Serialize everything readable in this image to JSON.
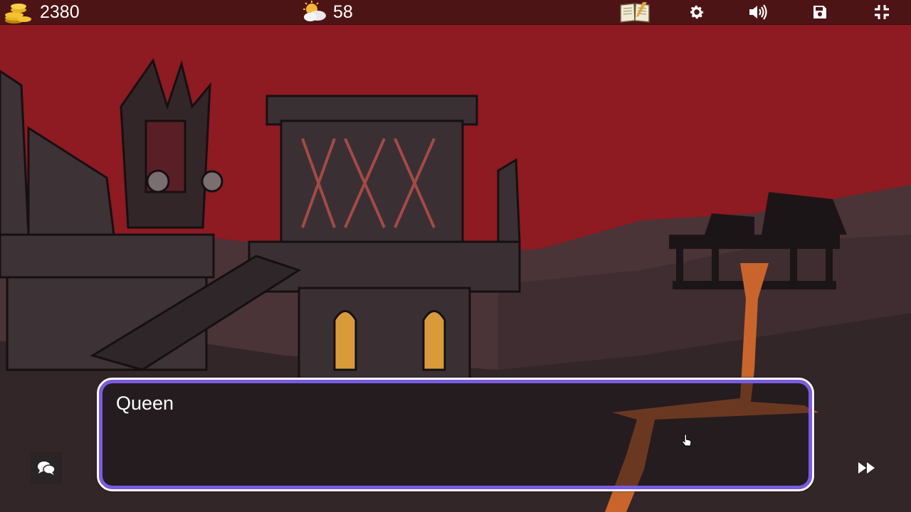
{
  "hud": {
    "gold": "2380",
    "weather_value": "58",
    "icons": {
      "gold": "coin-stack-icon",
      "weather": "sun-cloud-icon",
      "journal": "journal-book-icon",
      "settings": "gear-icon",
      "sound": "speaker-volume-icon",
      "save": "floppy-disk-icon",
      "fullscreen": "collapse-fullscreen-icon"
    }
  },
  "dialogue": {
    "speaker": "Queen",
    "text": ""
  },
  "controls": {
    "log_icon": "chat-bubbles-icon",
    "skip_icon": "fast-forward-icon"
  },
  "colors": {
    "sky": "#8e1a22",
    "hud_bar": "#4d1416",
    "dialogue_border": "#7b5ce0",
    "lava": "#c9652c"
  }
}
